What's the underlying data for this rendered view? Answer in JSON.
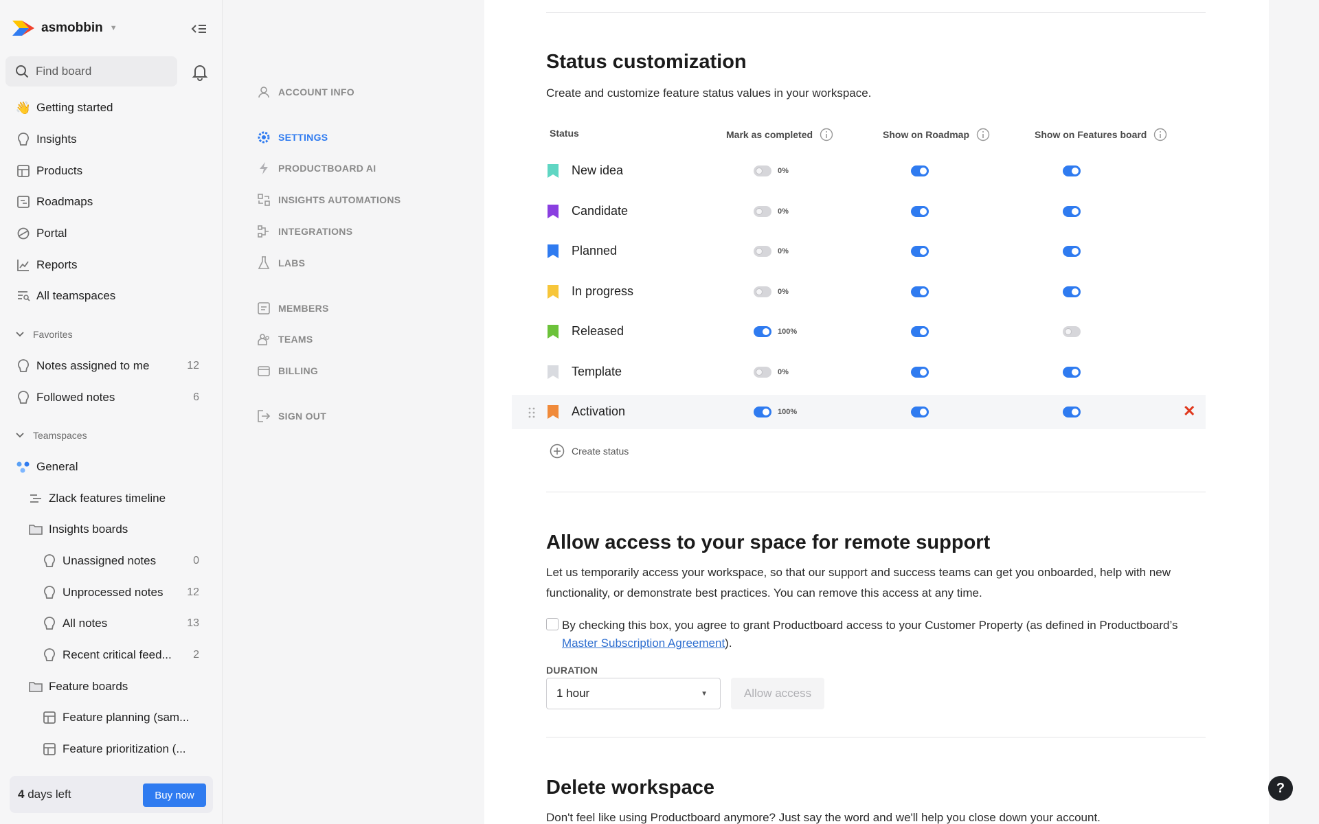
{
  "workspace": {
    "name": "asmobbin"
  },
  "sidebar": {
    "search_placeholder": "Find board",
    "items": [
      {
        "label": "Getting started",
        "icon": "wave-icon"
      },
      {
        "label": "Insights",
        "icon": "bulb-icon"
      },
      {
        "label": "Products",
        "icon": "grid-icon"
      },
      {
        "label": "Roadmaps",
        "icon": "roadmap-icon"
      },
      {
        "label": "Portal",
        "icon": "portal-icon"
      },
      {
        "label": "Reports",
        "icon": "chart-icon"
      },
      {
        "label": "All teamspaces",
        "icon": "list-search-icon"
      }
    ],
    "favorites_header": "Favorites",
    "favorites": [
      {
        "label": "Notes assigned to me",
        "count": "12"
      },
      {
        "label": "Followed notes",
        "count": "6"
      }
    ],
    "teamspaces_header": "Teamspaces",
    "teamspace": {
      "label": "General"
    },
    "boards": [
      {
        "label": "Zlack features timeline"
      },
      {
        "label": "Insights boards"
      },
      {
        "label": "Unassigned notes",
        "count": "0"
      },
      {
        "label": "Unprocessed notes",
        "count": "12"
      },
      {
        "label": "All notes",
        "count": "13"
      },
      {
        "label": "Recent critical feed...",
        "count": "2"
      },
      {
        "label": "Feature boards"
      },
      {
        "label": "Feature planning (sam..."
      },
      {
        "label": "Feature prioritization (..."
      }
    ],
    "trial": {
      "days": "4",
      "suffix": " days left",
      "buy_label": "Buy now"
    }
  },
  "settings_nav": [
    {
      "label": "ACCOUNT INFO"
    },
    {
      "label": "SETTINGS"
    },
    {
      "label": "PRODUCTBOARD AI"
    },
    {
      "label": "INSIGHTS AUTOMATIONS"
    },
    {
      "label": "INTEGRATIONS"
    },
    {
      "label": "LABS"
    },
    {
      "label": "MEMBERS"
    },
    {
      "label": "TEAMS"
    },
    {
      "label": "BILLING"
    },
    {
      "label": "SIGN OUT"
    }
  ],
  "status_section": {
    "title": "Status customization",
    "description": "Create and customize feature status values in your workspace.",
    "columns": [
      "Status",
      "Mark as completed",
      "Show on Roadmap",
      "Show on Features board"
    ],
    "rows": [
      {
        "name": "New idea",
        "color": "#5fd6c3",
        "completed": false,
        "pct": "0%",
        "roadmap": true,
        "features": true
      },
      {
        "name": "Candidate",
        "color": "#8a3fe0",
        "completed": false,
        "pct": "0%",
        "roadmap": true,
        "features": true
      },
      {
        "name": "Planned",
        "color": "#2f7bf0",
        "completed": false,
        "pct": "0%",
        "roadmap": true,
        "features": true
      },
      {
        "name": "In progress",
        "color": "#f7c63a",
        "completed": false,
        "pct": "0%",
        "roadmap": true,
        "features": true
      },
      {
        "name": "Released",
        "color": "#6cc23a",
        "completed": true,
        "pct": "100%",
        "roadmap": true,
        "features": false
      },
      {
        "name": "Template",
        "color": "#d9dbe0",
        "completed": false,
        "pct": "0%",
        "roadmap": true,
        "features": true
      },
      {
        "name": "Activation",
        "color": "#f08a3a",
        "completed": true,
        "pct": "100%",
        "roadmap": true,
        "features": true
      }
    ],
    "create_label": "Create status",
    "delete_glyph": "✕"
  },
  "access_section": {
    "title": "Allow access to your space for remote support",
    "description_line1": "Let us temporarily access your workspace, so that our support and success teams can get you onboarded, help with new",
    "description_line2": "functionality, or demonstrate best practices. You can remove this access at any time.",
    "agree_prefix": "By checking this box, you agree to grant Productboard access to your Customer Property (as defined in Productboard’s",
    "agree_link": "Master Subscription Agreement",
    "agree_suffix": ").",
    "duration_label": "DURATION",
    "duration_value": "1 hour",
    "allow_label": "Allow access"
  },
  "delete_section": {
    "title": "Delete workspace",
    "description": "Don't feel like using Productboard anymore? Just say the word and we'll help you close down your account."
  },
  "help": {
    "label": "?"
  },
  "colors": {
    "accent": "#2f7bf0",
    "danger": "#e0371c"
  }
}
